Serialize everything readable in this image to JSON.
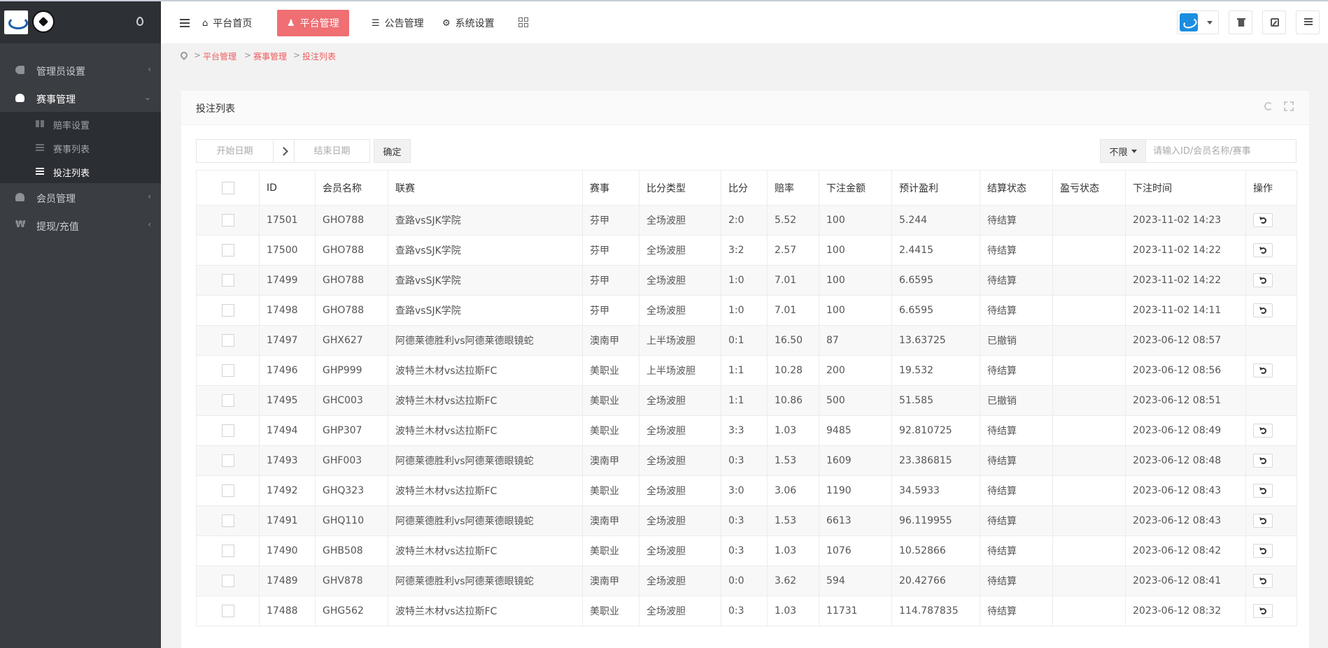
{
  "sidebar": {
    "menu": [
      {
        "label": "管理员设置",
        "icon": "key-icon",
        "arrow": "‹"
      },
      {
        "label": "赛事管理",
        "icon": "users-icon",
        "arrow": "⌄"
      },
      {
        "label": "会员管理",
        "icon": "user-icon",
        "arrow": "‹"
      },
      {
        "label": "提现/充值",
        "icon": "yen-icon",
        "arrow": "‹"
      }
    ],
    "submenu": [
      {
        "label": "赔率设置",
        "icon": "grid-icon"
      },
      {
        "label": "赛事列表",
        "icon": "list-icon"
      },
      {
        "label": "投注列表",
        "icon": "menu-icon"
      }
    ],
    "yen_glyph": "₩"
  },
  "header": {
    "tabs": [
      {
        "label": "平台首页",
        "icon": "home-icon",
        "glyph": "⌂"
      },
      {
        "label": "平台管理",
        "icon": "user-icon",
        "glyph": "♟"
      },
      {
        "label": "公告管理",
        "icon": "list-icon",
        "glyph": "☰"
      },
      {
        "label": "系统设置",
        "icon": "gear-icon",
        "glyph": "⚙"
      }
    ]
  },
  "breadcrumb": {
    "items": [
      "平台管理",
      "赛事管理",
      "投注列表"
    ],
    "separator": ">"
  },
  "panel": {
    "title": "投注列表",
    "date_start_placeholder": "开始日期",
    "date_end_placeholder": "结束日期",
    "confirm_label": "确定",
    "filter_label": "不限",
    "search_placeholder": "请输入ID/会员名称/赛事"
  },
  "table": {
    "columns": [
      "ID",
      "会员名称",
      "联赛",
      "赛事",
      "比分类型",
      "比分",
      "赔率",
      "下注金额",
      "预计盈利",
      "结算状态",
      "盈亏状态",
      "下注时间",
      "操作"
    ],
    "rows": [
      {
        "id": "17501",
        "member": "GHO788",
        "league": "查路vsSJK学院",
        "event": "芬甲",
        "score_type": "全场波胆",
        "score": "2:0",
        "odds": "5.52",
        "amount": "100",
        "profit": "5.244",
        "settle": "待结算",
        "pl": "",
        "time": "2023-11-02 14:23",
        "undo": true
      },
      {
        "id": "17500",
        "member": "GHO788",
        "league": "查路vsSJK学院",
        "event": "芬甲",
        "score_type": "全场波胆",
        "score": "3:2",
        "odds": "2.57",
        "amount": "100",
        "profit": "2.4415",
        "settle": "待结算",
        "pl": "",
        "time": "2023-11-02 14:22",
        "undo": true
      },
      {
        "id": "17499",
        "member": "GHO788",
        "league": "查路vsSJK学院",
        "event": "芬甲",
        "score_type": "全场波胆",
        "score": "1:0",
        "odds": "7.01",
        "amount": "100",
        "profit": "6.6595",
        "settle": "待结算",
        "pl": "",
        "time": "2023-11-02 14:22",
        "undo": true
      },
      {
        "id": "17498",
        "member": "GHO788",
        "league": "查路vsSJK学院",
        "event": "芬甲",
        "score_type": "全场波胆",
        "score": "1:0",
        "odds": "7.01",
        "amount": "100",
        "profit": "6.6595",
        "settle": "待结算",
        "pl": "",
        "time": "2023-11-02 14:11",
        "undo": true
      },
      {
        "id": "17497",
        "member": "GHX627",
        "league": "阿德莱德胜利vs阿德莱德眼镜蛇",
        "event": "澳南甲",
        "score_type": "上半场波胆",
        "score": "0:1",
        "odds": "16.50",
        "amount": "87",
        "profit": "13.63725",
        "settle": "已撤销",
        "pl": "",
        "time": "2023-06-12 08:57",
        "undo": false
      },
      {
        "id": "17496",
        "member": "GHP999",
        "league": "波特兰木材vs达拉斯FC",
        "event": "美职业",
        "score_type": "上半场波胆",
        "score": "1:1",
        "odds": "10.28",
        "amount": "200",
        "profit": "19.532",
        "settle": "待结算",
        "pl": "",
        "time": "2023-06-12 08:56",
        "undo": true
      },
      {
        "id": "17495",
        "member": "GHC003",
        "league": "波特兰木材vs达拉斯FC",
        "event": "美职业",
        "score_type": "全场波胆",
        "score": "1:1",
        "odds": "10.86",
        "amount": "500",
        "profit": "51.585",
        "settle": "已撤销",
        "pl": "",
        "time": "2023-06-12 08:51",
        "undo": false
      },
      {
        "id": "17494",
        "member": "GHP307",
        "league": "波特兰木材vs达拉斯FC",
        "event": "美职业",
        "score_type": "全场波胆",
        "score": "3:3",
        "odds": "1.03",
        "amount": "9485",
        "profit": "92.810725",
        "settle": "待结算",
        "pl": "",
        "time": "2023-06-12 08:49",
        "undo": true
      },
      {
        "id": "17493",
        "member": "GHF003",
        "league": "阿德莱德胜利vs阿德莱德眼镜蛇",
        "event": "澳南甲",
        "score_type": "全场波胆",
        "score": "0:3",
        "odds": "1.53",
        "amount": "1609",
        "profit": "23.386815",
        "settle": "待结算",
        "pl": "",
        "time": "2023-06-12 08:48",
        "undo": true
      },
      {
        "id": "17492",
        "member": "GHQ323",
        "league": "波特兰木材vs达拉斯FC",
        "event": "美职业",
        "score_type": "全场波胆",
        "score": "3:0",
        "odds": "3.06",
        "amount": "1190",
        "profit": "34.5933",
        "settle": "待结算",
        "pl": "",
        "time": "2023-06-12 08:43",
        "undo": true
      },
      {
        "id": "17491",
        "member": "GHQ110",
        "league": "阿德莱德胜利vs阿德莱德眼镜蛇",
        "event": "澳南甲",
        "score_type": "全场波胆",
        "score": "0:3",
        "odds": "1.53",
        "amount": "6613",
        "profit": "96.119955",
        "settle": "待结算",
        "pl": "",
        "time": "2023-06-12 08:43",
        "undo": true
      },
      {
        "id": "17490",
        "member": "GHB508",
        "league": "波特兰木材vs达拉斯FC",
        "event": "美职业",
        "score_type": "全场波胆",
        "score": "0:3",
        "odds": "1.03",
        "amount": "1076",
        "profit": "10.52866",
        "settle": "待结算",
        "pl": "",
        "time": "2023-06-12 08:42",
        "undo": true
      },
      {
        "id": "17489",
        "member": "GHV878",
        "league": "阿德莱德胜利vs阿德莱德眼镜蛇",
        "event": "澳南甲",
        "score_type": "全场波胆",
        "score": "0:0",
        "odds": "3.62",
        "amount": "594",
        "profit": "20.42766",
        "settle": "待结算",
        "pl": "",
        "time": "2023-06-12 08:41",
        "undo": true
      },
      {
        "id": "17488",
        "member": "GHG562",
        "league": "波特兰木材vs达拉斯FC",
        "event": "美职业",
        "score_type": "全场波胆",
        "score": "0:3",
        "odds": "1.03",
        "amount": "11731",
        "profit": "114.787835",
        "settle": "待结算",
        "pl": "",
        "time": "2023-06-12 08:32",
        "undo": true
      }
    ]
  },
  "colors": {
    "sidebar_bg": "#3a3d41",
    "accent": "#ef6f73",
    "link": "#ef5b5f"
  }
}
